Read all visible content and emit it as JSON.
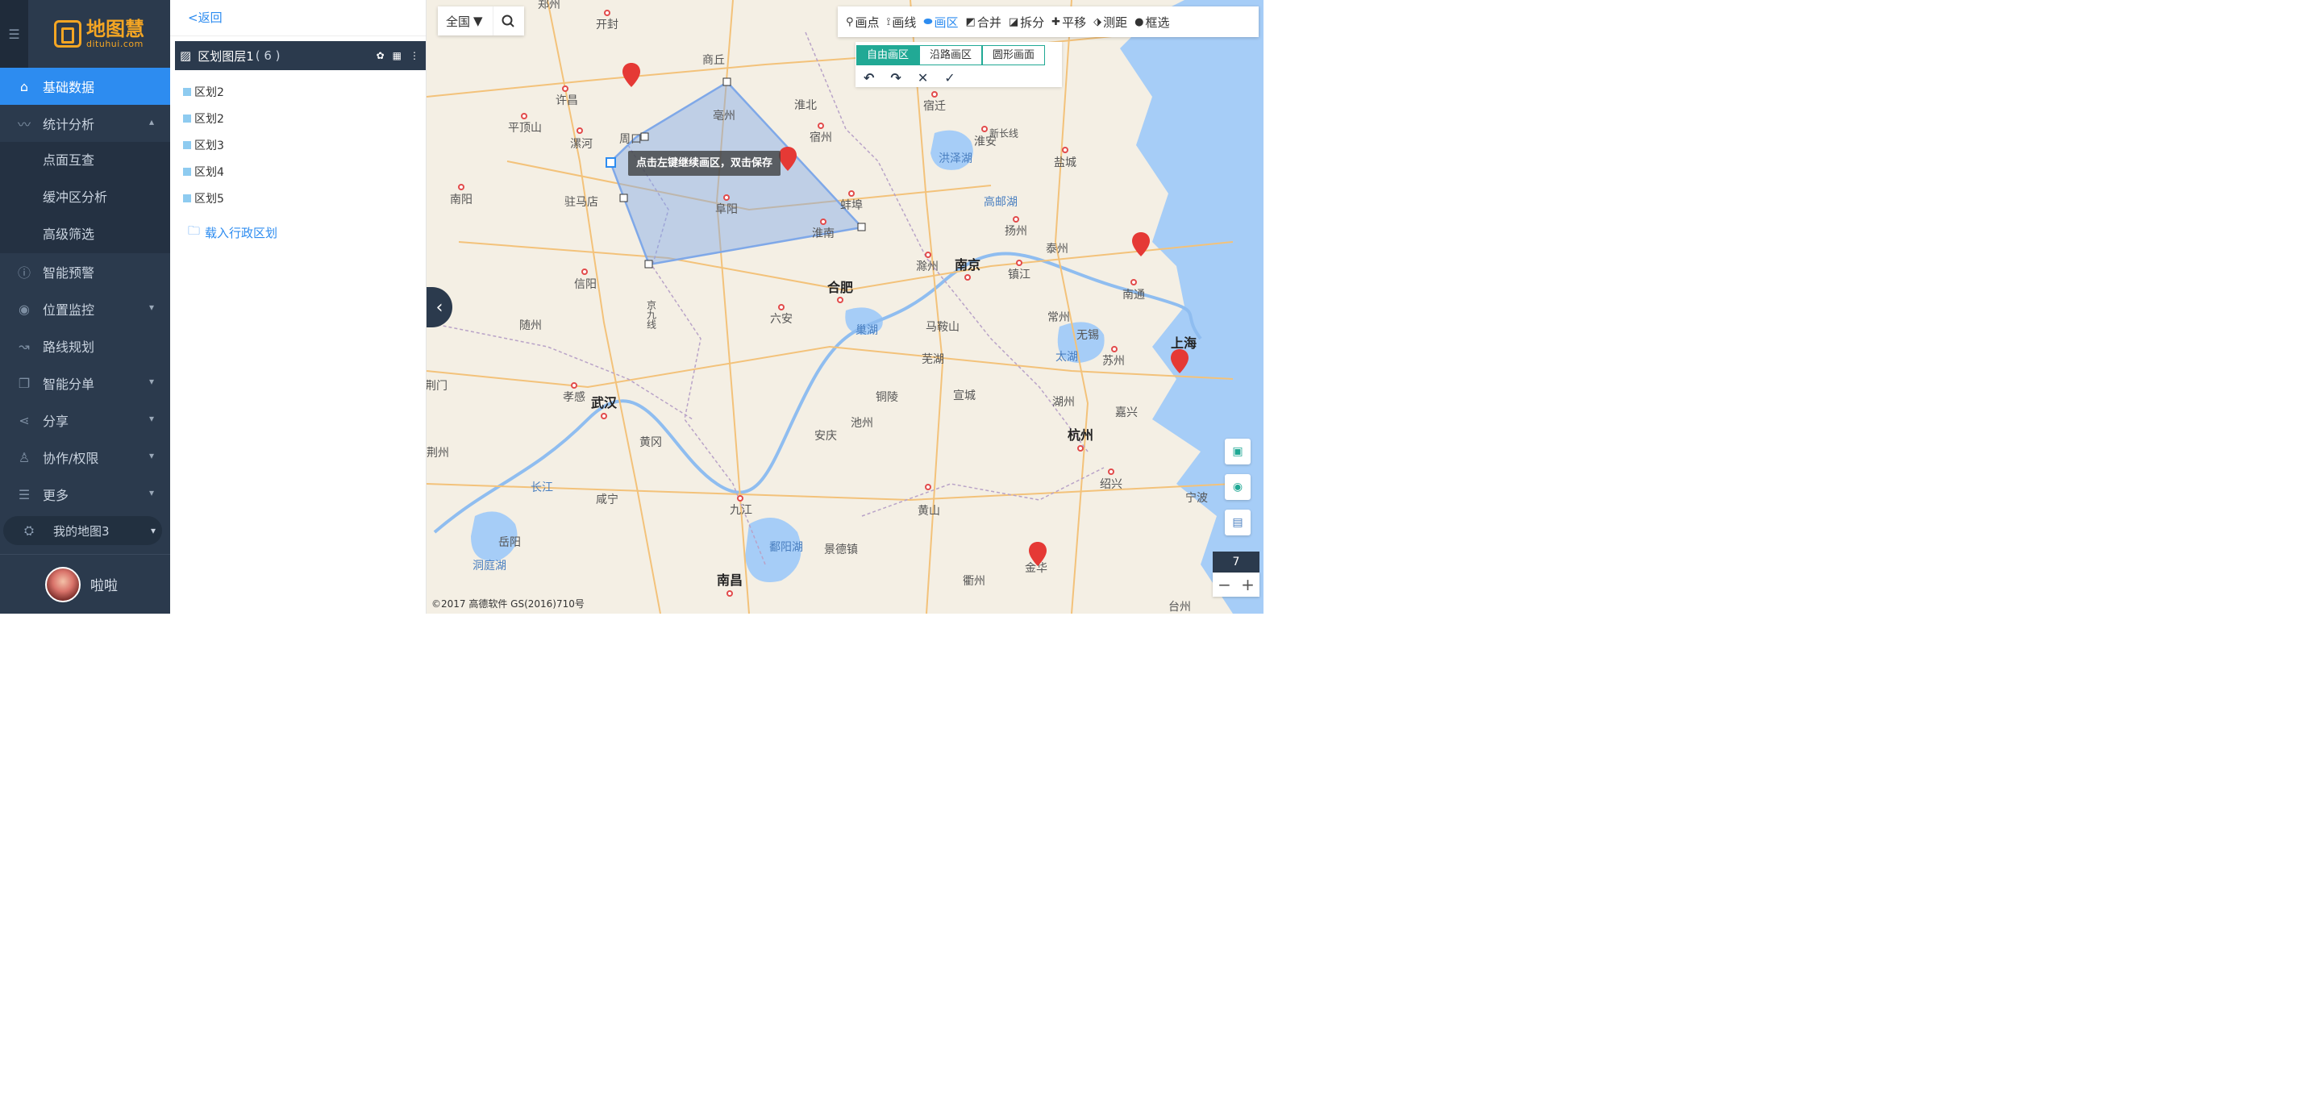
{
  "sidebar": {
    "logo_cn": "地图慧",
    "logo_en": "dituhui.com",
    "items": [
      {
        "label": "基础数据",
        "icon": "home-icon",
        "active": true
      },
      {
        "label": "统计分析",
        "icon": "trend-icon",
        "expanded": true,
        "children": [
          "点面互查",
          "缓冲区分析",
          "高级筛选"
        ]
      },
      {
        "label": "智能预警",
        "icon": "info-icon"
      },
      {
        "label": "位置监控",
        "icon": "location-icon"
      },
      {
        "label": "路线规划",
        "icon": "route-icon"
      },
      {
        "label": "智能分单",
        "icon": "copy-icon"
      },
      {
        "label": "分享",
        "icon": "share-icon"
      },
      {
        "label": "协作/权限",
        "icon": "user-icon"
      },
      {
        "label": "更多",
        "icon": "list-icon"
      }
    ],
    "my_map": "我的地图3",
    "username": "啦啦"
  },
  "panel": {
    "back": "<返回",
    "layer_title": "区划图层1",
    "layer_count": "( 6 )",
    "items": [
      "区划2",
      "区划2",
      "区划3",
      "区划4",
      "区划5"
    ],
    "load_label": "载入行政区划"
  },
  "map": {
    "region": "全国",
    "tools": [
      {
        "label": "画点",
        "icon": "pin-icon"
      },
      {
        "label": "画线",
        "icon": "polyline-icon"
      },
      {
        "label": "画区",
        "icon": "polygon-icon",
        "active": true
      },
      {
        "label": "合并",
        "icon": "merge-icon"
      },
      {
        "label": "拆分",
        "icon": "split-icon"
      },
      {
        "label": "平移",
        "icon": "move-icon"
      },
      {
        "label": "测距",
        "icon": "ruler-icon"
      },
      {
        "label": "框选",
        "icon": "lasso-icon"
      }
    ],
    "draw_modes": [
      "自由画区",
      "沿路画区",
      "圆形画面"
    ],
    "active_mode": "自由画区",
    "tooltip": "点击左键继续画区，双击保存",
    "zoom_level": "7",
    "zoom_in": "+",
    "zoom_out": "−",
    "copyright": "©2017 高德软件 GS(2016)710号",
    "colors": {
      "accent": "#2d8cf0",
      "mode": "#21a995",
      "polygon": "#7fa8e8"
    },
    "cities": [
      {
        "name": "郑州",
        "big": false
      },
      {
        "name": "开封"
      },
      {
        "name": "商丘"
      },
      {
        "name": "许昌"
      },
      {
        "name": "平顶山"
      },
      {
        "name": "漯河"
      },
      {
        "name": "周口"
      },
      {
        "name": "亳州"
      },
      {
        "name": "淮北"
      },
      {
        "name": "宿州"
      },
      {
        "name": "宿迁"
      },
      {
        "name": "淮安"
      },
      {
        "name": "盐城"
      },
      {
        "name": "南阳"
      },
      {
        "name": "驻马店"
      },
      {
        "name": "阜阳"
      },
      {
        "name": "蚌埠"
      },
      {
        "name": "淮南"
      },
      {
        "name": "扬州"
      },
      {
        "name": "泰州"
      },
      {
        "name": "南通"
      },
      {
        "name": "信阳"
      },
      {
        "name": "合肥",
        "big": true
      },
      {
        "name": "南京",
        "big": true
      },
      {
        "name": "滁州"
      },
      {
        "name": "镇江"
      },
      {
        "name": "常州"
      },
      {
        "name": "无锡"
      },
      {
        "name": "上海",
        "big": true
      },
      {
        "name": "苏州"
      },
      {
        "name": "六安"
      },
      {
        "name": "马鞍山"
      },
      {
        "name": "随州"
      },
      {
        "name": "芜湖"
      },
      {
        "name": "宣城"
      },
      {
        "name": "湖州"
      },
      {
        "name": "嘉兴"
      },
      {
        "name": "孝感"
      },
      {
        "name": "武汉",
        "big": true
      },
      {
        "name": "铜陵"
      },
      {
        "name": "池州"
      },
      {
        "name": "安庆"
      },
      {
        "name": "杭州",
        "big": true
      },
      {
        "name": "荆州"
      },
      {
        "name": "黄冈"
      },
      {
        "name": "绍兴"
      },
      {
        "name": "宁波"
      },
      {
        "name": "咸宁"
      },
      {
        "name": "九江"
      },
      {
        "name": "黄山"
      },
      {
        "name": "岳阳"
      },
      {
        "name": "景德镇"
      },
      {
        "name": "南昌",
        "big": true
      },
      {
        "name": "衢州"
      },
      {
        "name": "金华"
      },
      {
        "name": "台州"
      },
      {
        "name": "荆门"
      }
    ],
    "water_labels": [
      "洪泽湖",
      "高邮湖",
      "巢湖",
      "太湖",
      "鄱阳湖",
      "洞庭湖",
      "长江",
      "新长线",
      "京九线"
    ]
  }
}
